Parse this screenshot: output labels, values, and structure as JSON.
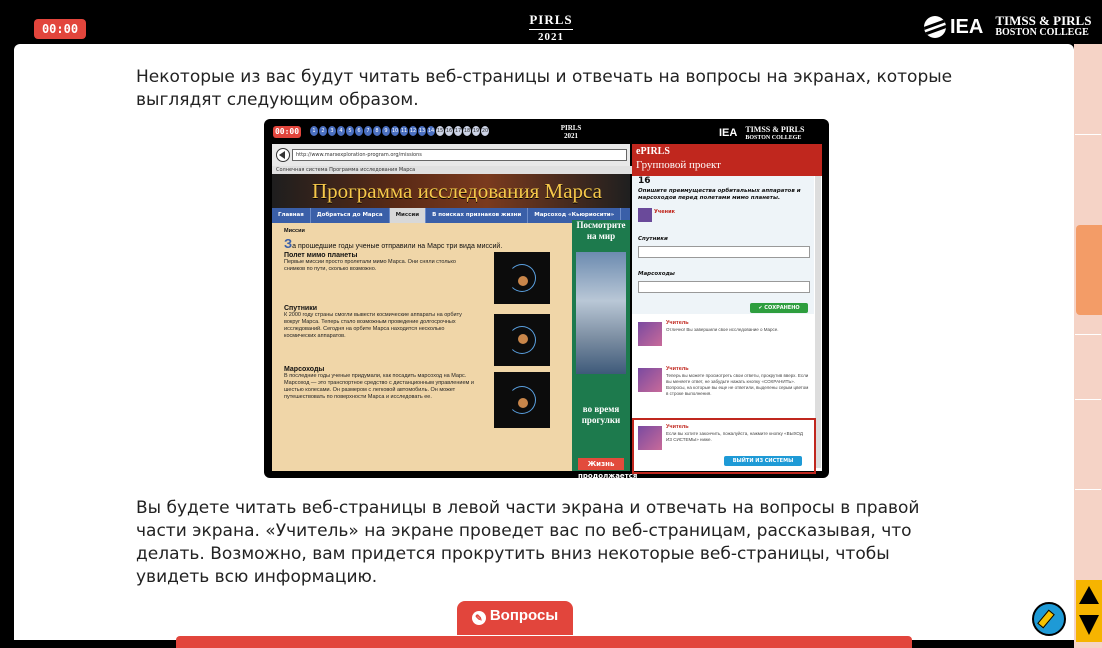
{
  "header": {
    "timer": "00:00",
    "pirls_top": "PIRLS",
    "pirls_year": "2021",
    "iea": "IEA",
    "timss_pirls": "TIMSS & PIRLS",
    "boston_college": "BOSTON COLLEGE"
  },
  "main": {
    "paragraph1": "Некоторые из вас будут читать веб-страницы и отвечать на вопросы на экранах, которые выглядят следующим образом.",
    "paragraph2": "Вы будете читать веб-страницы в левой части экрана и отвечать на вопросы в правой части экрана. «Учитель» на экране проведет вас по веб-страницам, рассказывая, что делать. Возможно, вам придется прокрутить вниз некоторые веб-страницы, чтобы увидеть всю информацию."
  },
  "screenshot": {
    "timer": "00:00",
    "dots": [
      "1",
      "2",
      "3",
      "4",
      "5",
      "6",
      "7",
      "8",
      "9",
      "10",
      "11",
      "12",
      "13",
      "14",
      "15",
      "16",
      "17",
      "18",
      "19",
      "20"
    ],
    "pirls": "PIRLS",
    "pirls_year": "2021",
    "iea": "IEA",
    "timss_pirls": "TIMSS & PIRLS",
    "boston_college": "BOSTON COLLEGE",
    "url": "http://www.marsexploration-program.org/missions",
    "breadcrumb": "Солнечная система    Программа исследования Марса",
    "site_title": "Программа исследования Марса",
    "nav": [
      "Главная",
      "Добраться до Марса",
      "Миссии",
      "В поисках признаков жизни",
      "Марсоход «Кьюриосити»"
    ],
    "section_label": "Миссии",
    "intro_cap": "З",
    "intro_rest": "а прошедшие годы ученые отправили на Марс три вида миссий.",
    "sections": [
      {
        "title": "Полет мимо планеты",
        "text": "Первые миссии просто пролетали мимо Марса. Они сняли столько снимков по пути, сколько возможно."
      },
      {
        "title": "Спутники",
        "text": "К 2000 году страны смогли вывести космические аппараты на орбиту вокруг Марса. Теперь стало возможным проведение долгосрочных исследований. Сегодня на орбите Марса находится несколько космических аппаратов."
      },
      {
        "title": "Марсоходы",
        "text": "В последние годы ученые придумали, как посадить марсоход на Марс. Марсоход — это транспортное средство с дистанционным управлением и шестью колесами. Он размером с легковой автомобиль. Он может путешествовать по поверхности Марса и исследовать ее."
      }
    ],
    "ad_top": "Посмотрите на мир",
    "ad_bottom": "во время прогулки",
    "ad_button": "Жизнь продолжается",
    "right_e": "ePIRLS",
    "right_title": "Групповой проект",
    "q_number": "16",
    "q_text": "Опишите преимущества орбитальных аппаратов и марсоходов перед полетами мимо планеты.",
    "student": "Ученик",
    "field1": "Спутники",
    "field2": "Марсоходы",
    "saved": "✔ СОХРАНЕНО",
    "messages": [
      {
        "who": "Учитель",
        "text": "Отлично! Вы завершили свое исследование о Марсе."
      },
      {
        "who": "Учитель",
        "text": "Теперь вы можете просмотреть свои ответы, прокрутив вверх. Если вы меняете ответ, не забудьте нажать кнопку «СОХРАНИТЬ». Вопросы, на которые вы еще не ответили, выделены серым цветом в строке выполнения."
      },
      {
        "who": "Учитель",
        "text": "Если вы хотите закончить, пожалуйста, нажмите кнопку «ВЫХОД ИЗ СИСТЕМЫ» ниже."
      }
    ],
    "logout": "ВЫЙТИ ИЗ СИСТЕМЫ"
  },
  "footer": {
    "questions_button": "Вопросы",
    "pen_icon": "pencil-icon",
    "help_icon": "help-pencil-icon"
  },
  "colors": {
    "accent": "#e2453c",
    "rail": "#f5d3c6",
    "rail_active": "#f39c67",
    "scroll": "#f6b400"
  }
}
